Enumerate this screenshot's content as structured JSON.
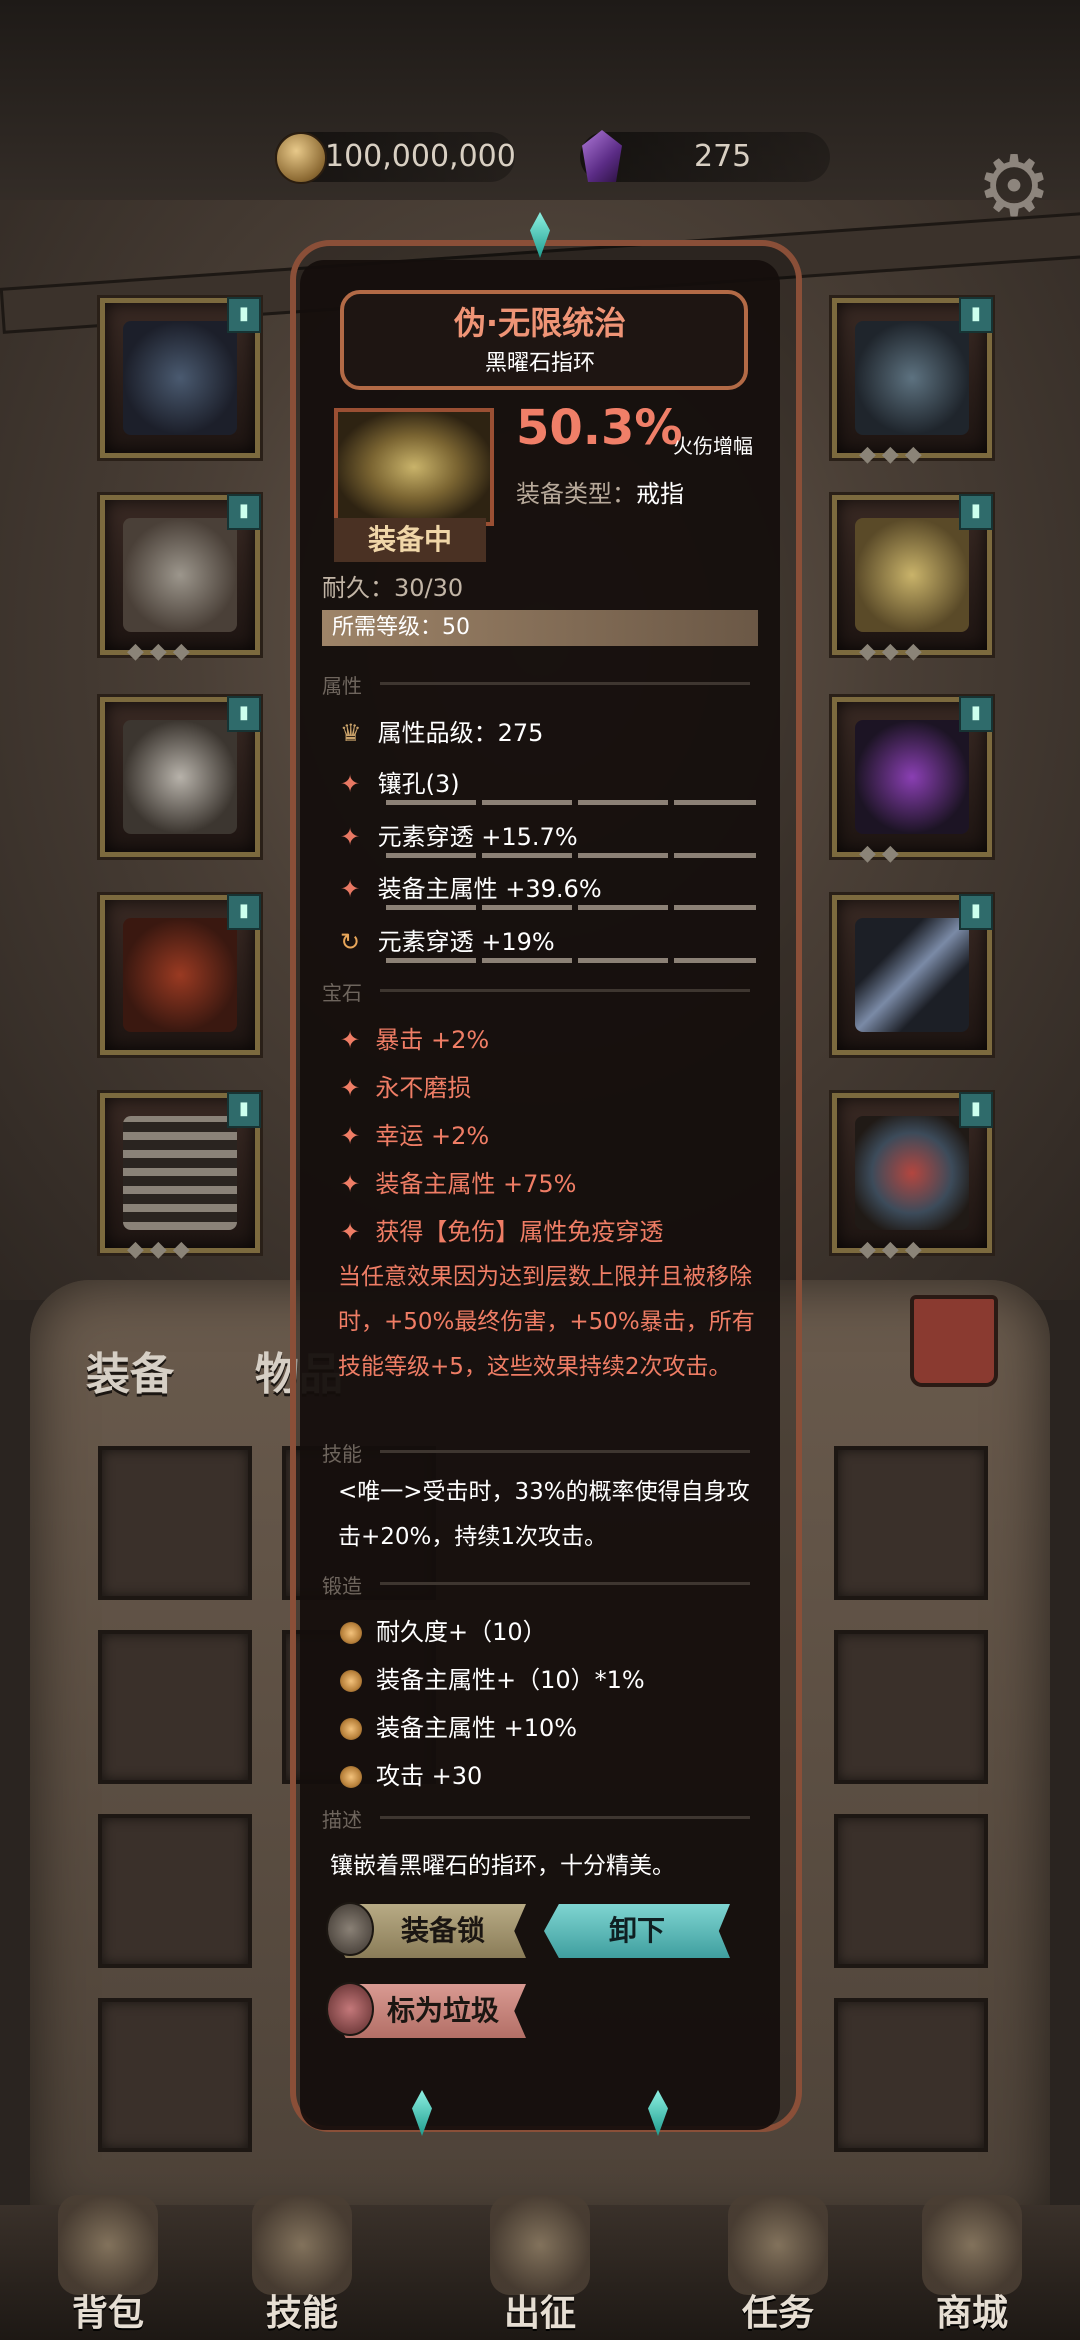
{
  "currency": {
    "gold": "100,000,000",
    "gems": "275"
  },
  "tabs": {
    "equipment": "装备",
    "items": "物品"
  },
  "item": {
    "name": "伪·无限统治",
    "type_name": "黑曜石指环",
    "status": "装备中",
    "main_value": "50.3%",
    "main_stat": "火伤增幅",
    "type_label": "装备类型：",
    "type_value": "戒指",
    "durability": "耐久：30/30",
    "required_level": "所需等级：50"
  },
  "sections": {
    "attributes": "属性",
    "gems": "宝石",
    "skill": "技能",
    "forge": "锻造",
    "description": "描述"
  },
  "attributes": [
    "属性品级：275",
    "镶孔(3)",
    "元素穿透 +15.7%",
    "装备主属性 +39.6%",
    "元素穿透 +19%"
  ],
  "gem_effects": [
    "暴击 +2%",
    "永不磨损",
    "幸运 +2%",
    "装备主属性 +75%",
    "获得【免伤】属性免疫穿透"
  ],
  "set_effect": "当任意效果因为达到层数上限并且被移除时，+50%最终伤害，+50%暴击，所有技能等级+5，这些效果持续2次攻击。",
  "skill_text": "<唯一>受击时，33%的概率使得自身攻击+20%，持续1次攻击。",
  "forge": [
    "耐久度+（10）",
    "装备主属性+（10）*1%",
    "装备主属性 +10%",
    "攻击 +30"
  ],
  "description": "镶嵌着黑曜石的指环，十分精美。",
  "buttons": {
    "lock": "装备锁",
    "unequip": "卸下",
    "junk": "标为垃圾"
  },
  "nav": [
    "背包",
    "技能",
    "出征",
    "任务",
    "商城"
  ],
  "colors": {
    "title": "#ef9476",
    "gem_text": "#ef7d65",
    "accent_teal": "#3f9f9f"
  },
  "icons": {
    "settings": "gear-icon",
    "gold": "coin-icon",
    "gems": "gem-icon",
    "trash": "trash-icon"
  }
}
